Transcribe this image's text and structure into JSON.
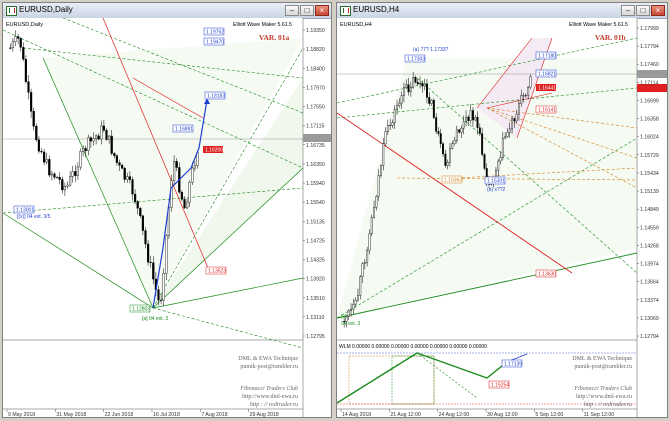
{
  "left": {
    "title": "EURUSD,Daily",
    "symbol_label": "EURUSD,Daily",
    "maker": "Elliott Wave Maker 5.61.5",
    "variant": "VAR. 01a",
    "wave_labels": {
      "bottom": "[a] 04 ext. 3",
      "left": "[(x)] 04 ext. 3/5"
    },
    "price_tags": {
      "t1": "1.19762",
      "t2": "1.19470",
      "t3": "1.18183",
      "t4": "1.16891",
      "t5": "1.16781",
      "t6": "1.13523",
      "t7": "1.16200",
      "t8": "1.13001",
      "t9": "1.12803"
    },
    "footer": {
      "line1": "DML & EWA Technique",
      "line2": "pumik-post@rambler.ru",
      "line3": "Fibonacci Traders Club",
      "line4": "http://www.dml-ewa.ru",
      "line5": "http : // redtrader.ru"
    },
    "y_ticks": [
      "1.19350",
      "1.18820",
      "1.18400",
      "1.17970",
      "1.17550",
      "1.17115",
      "1.16735",
      "1.16350",
      "1.15940",
      "1.15540",
      "1.15135",
      "1.14725",
      "1.14325",
      "1.13920",
      "1.13510",
      "1.13110",
      "1.12795"
    ],
    "x_ticks": [
      "9 May 2018",
      "31 May 2018",
      "22 Jun 2018",
      "16 Jul 2018",
      "7 Aug 2018",
      "29 Aug 2018"
    ]
  },
  "right": {
    "title": "EURUSD,H4",
    "symbol_label": "EURUSD,H4",
    "maker": "Elliott Wave Maker 5.61.5",
    "variant": "VAR. 01b",
    "wave_labels": {
      "top": "(a) 77? 1.1733?",
      "mid": "(b) x??2",
      "bottom": "(v)",
      "bottom2": "04 ext. 3"
    },
    "price_tags": {
      "r1": "1.17303",
      "r2": "1.17180",
      "r3": "1.16821",
      "r4": "1.16441",
      "r5": "1.15363",
      "r6": "1.16141",
      "r7": "1.15301",
      "r8": "1.13630"
    },
    "osc_label": "WLM 0.00000 0.00000 0.00000 0.00000 0.00000 0.00000 0.00000",
    "osc_tags": {
      "o1": "1.17139",
      "o2": "1.16534",
      "o3": "1.15254"
    },
    "footer": {
      "line1": "DML & EWA Technique",
      "line2": "pumik-post@rambler.ru",
      "line3": "Fibonacci Traders Club",
      "line4": "http://www.dml-ewa.ru",
      "line5": "http : // redtrader.ru"
    },
    "y_ticks": [
      "1.17999",
      "1.17794",
      "1.17460",
      "1.17114",
      "1.16699",
      "1.16358",
      "1.16024",
      "1.15729",
      "1.15434",
      "1.15139",
      "1.14849",
      "1.14559",
      "1.14268",
      "1.13974",
      "1.13664",
      "1.13374",
      "1.13069",
      "1.12794"
    ],
    "x_ticks": [
      "14 Aug 2018",
      "21 Aug 12:00",
      "24 Aug 12:00",
      "30 Aug 12:00",
      "5 Sep 12:00",
      "11 Sep 12:00"
    ]
  },
  "colors": {
    "bull": "#000000",
    "bear": "#000000",
    "red": "#e02020",
    "green": "#1a8a1a",
    "blue": "#1f3fd0",
    "orange": "#d08020"
  }
}
